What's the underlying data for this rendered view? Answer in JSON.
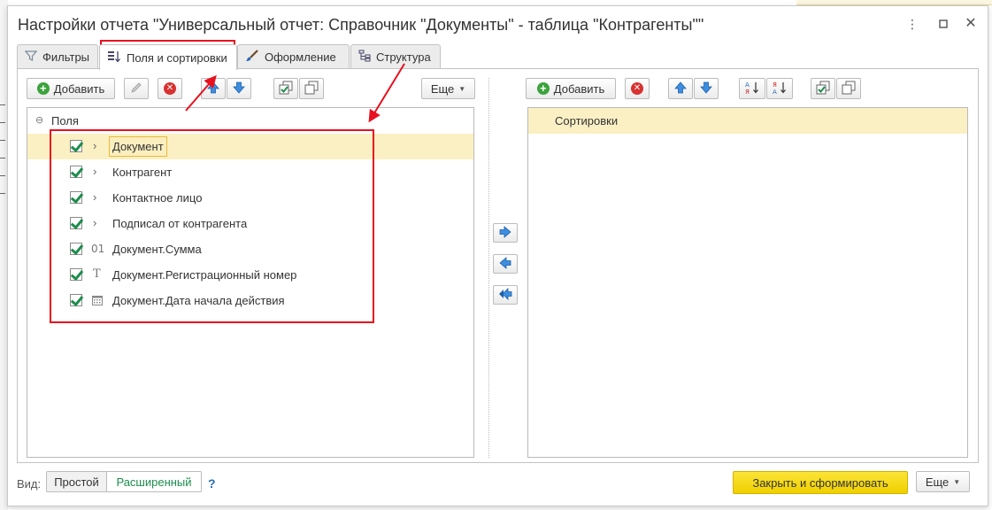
{
  "window": {
    "title": "Настройки отчета \"Универсальный отчет: Справочник \"Документы\" - таблица \"Контрагенты\"\"",
    "menu_icon": "kebab-menu-icon",
    "maximize_icon": "maximize-icon",
    "close_icon": "close-icon"
  },
  "tabs": [
    {
      "label": "Фильтры",
      "icon": "filter-icon"
    },
    {
      "label": "Поля и сортировки",
      "icon": "fields-sort-icon"
    },
    {
      "label": "Оформление",
      "icon": "brush-icon"
    },
    {
      "label": "Структура",
      "icon": "structure-icon"
    }
  ],
  "left_toolbar": {
    "add_label": "Добавить",
    "more_label": "Еще"
  },
  "fields": {
    "root_label": "Поля",
    "items": [
      {
        "label": "Документ",
        "type": "expandable",
        "checked": true
      },
      {
        "label": "Контрагент",
        "type": "expandable",
        "checked": true
      },
      {
        "label": "Контактное лицо",
        "type": "expandable",
        "checked": true
      },
      {
        "label": "Подписал от контрагента",
        "type": "expandable",
        "checked": true
      },
      {
        "label": "Документ.Сумма",
        "type": "number",
        "type_glyph": "01",
        "checked": true
      },
      {
        "label": "Документ.Регистрационный номер",
        "type": "string",
        "type_glyph": "T",
        "checked": true
      },
      {
        "label": "Документ.Дата начала действия",
        "type": "date",
        "type_glyph": "calendar-icon",
        "checked": true
      }
    ]
  },
  "right_toolbar": {
    "add_label": "Добавить"
  },
  "sort": {
    "header": "Сортировки"
  },
  "footer": {
    "view_label": "Вид:",
    "view_simple": "Простой",
    "view_extended": "Расширенный",
    "help": "?",
    "close_generate": "Закрыть и сформировать",
    "more_label": "Еще"
  },
  "colors": {
    "highlight": "#e8101e",
    "primary_button": "#f5d90b",
    "selected_row": "#fbf0c4",
    "checkbox": "#1d8d4d"
  }
}
